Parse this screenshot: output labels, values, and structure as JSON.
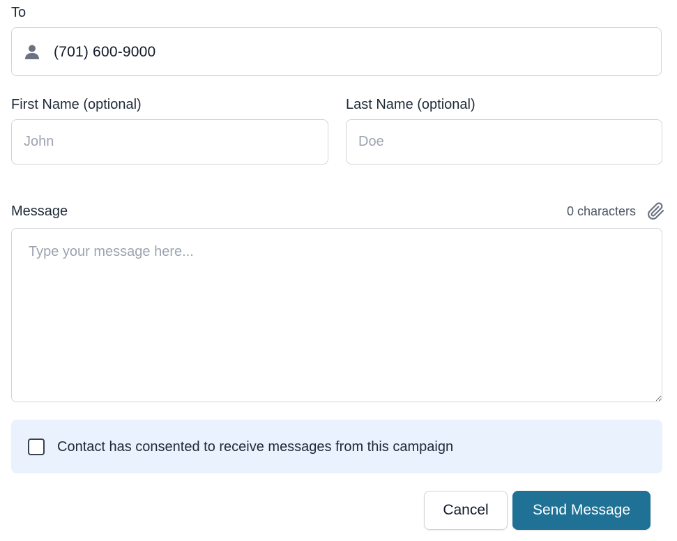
{
  "to": {
    "label": "To",
    "value": "(701) 600-9000",
    "icon": "person-icon"
  },
  "first_name": {
    "label": "First Name (optional)",
    "placeholder": "John",
    "value": ""
  },
  "last_name": {
    "label": "Last Name (optional)",
    "placeholder": "Doe",
    "value": ""
  },
  "message": {
    "label": "Message",
    "placeholder": "Type your message here...",
    "value": "",
    "char_count": "0 characters",
    "attach_icon": "paperclip-icon"
  },
  "consent": {
    "label": "Contact has consented to receive messages from this campaign",
    "checked": false,
    "background": "#eaf2fd"
  },
  "actions": {
    "cancel_label": "Cancel",
    "send_label": "Send Message",
    "send_color": "#1f7196"
  }
}
